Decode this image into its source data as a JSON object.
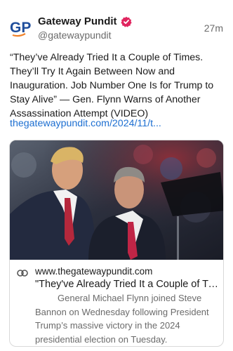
{
  "author": {
    "name": "Gateway Pundit",
    "handle": "@gatewaypundit",
    "avatar_text": "GP",
    "verified": true
  },
  "time": "27m",
  "post": {
    "text": "“They’ve Already Tried It a Couple of Times. They’ll Try It Again Between Now and Inauguration. Job Number One Is for Trump to Stay Alive” — Gen. Flynn Warns of Another Assassination Attempt (VIDEO)",
    "link": "thegatewaypundit.com/2024/11/t..."
  },
  "card": {
    "domain": "www.thegatewaypundit.com",
    "title": "\"They've Already Tried It a Couple of Times...",
    "description": "General Michael Flynn joined Steve Bannon on Wednesday following President Trump’s massive victory in the 2024 presidential election on Tuesday.",
    "link_icon": "link-icon"
  },
  "colors": {
    "link": "#1d6fd1",
    "verified": "#e0245e",
    "avatar_blue": "#1f4e9c",
    "avatar_orange": "#f0822a"
  }
}
